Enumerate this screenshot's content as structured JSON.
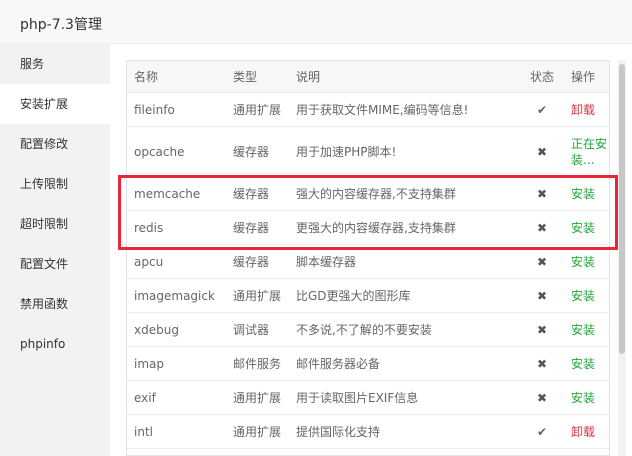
{
  "window": {
    "title": "php-7.3管理"
  },
  "sidebar": {
    "items": [
      {
        "label": "服务"
      },
      {
        "label": "安装扩展"
      },
      {
        "label": "配置修改"
      },
      {
        "label": "上传限制"
      },
      {
        "label": "超时限制"
      },
      {
        "label": "配置文件"
      },
      {
        "label": "禁用函数"
      },
      {
        "label": "phpinfo"
      }
    ],
    "active_index": 1
  },
  "table": {
    "headers": {
      "name": "名称",
      "type": "类型",
      "desc": "说明",
      "status": "状态",
      "op": "操作"
    },
    "rows": [
      {
        "name": "fileinfo",
        "type": "通用扩展",
        "desc": "用于获取文件MIME,编码等信息!",
        "status": "installed",
        "status_icon": "check-icon",
        "op": "卸载",
        "op_kind": "uninstall"
      },
      {
        "name": "opcache",
        "type": "缓存器",
        "desc": "用于加速PHP脚本!",
        "status": "not-installed",
        "status_icon": "x-icon",
        "op": "正在安装...",
        "op_kind": "installing"
      },
      {
        "name": "memcache",
        "type": "缓存器",
        "desc": "强大的内容缓存器,不支持集群",
        "status": "not-installed",
        "status_icon": "x-icon",
        "op": "安装",
        "op_kind": "install"
      },
      {
        "name": "redis",
        "type": "缓存器",
        "desc": "更强大的内容缓存器,支持集群",
        "status": "not-installed",
        "status_icon": "x-icon",
        "op": "安装",
        "op_kind": "install"
      },
      {
        "name": "apcu",
        "type": "缓存器",
        "desc": "脚本缓存器",
        "status": "not-installed",
        "status_icon": "x-icon",
        "op": "安装",
        "op_kind": "install"
      },
      {
        "name": "imagemagick",
        "type": "通用扩展",
        "desc": "比GD更强大的图形库",
        "status": "not-installed",
        "status_icon": "x-icon",
        "op": "安装",
        "op_kind": "install"
      },
      {
        "name": "xdebug",
        "type": "调试器",
        "desc": "不多说,不了解的不要安装",
        "status": "not-installed",
        "status_icon": "x-icon",
        "op": "安装",
        "op_kind": "install"
      },
      {
        "name": "imap",
        "type": "邮件服务",
        "desc": "邮件服务器必备",
        "status": "not-installed",
        "status_icon": "x-icon",
        "op": "安装",
        "op_kind": "install"
      },
      {
        "name": "exif",
        "type": "通用扩展",
        "desc": "用于读取图片EXIF信息",
        "status": "not-installed",
        "status_icon": "x-icon",
        "op": "安装",
        "op_kind": "install"
      },
      {
        "name": "intl",
        "type": "通用扩展",
        "desc": "提供国际化支持",
        "status": "installed",
        "status_icon": "check-icon",
        "op": "卸载",
        "op_kind": "uninstall"
      }
    ]
  },
  "colors": {
    "install": "#20a53a",
    "uninstall": "#d9333f",
    "highlight": "#e8283a"
  }
}
